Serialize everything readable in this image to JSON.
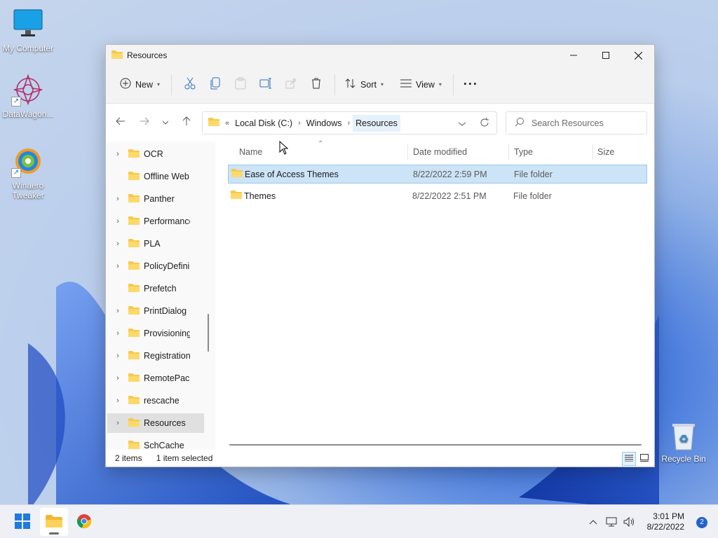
{
  "desktop": {
    "icons": [
      {
        "label": "My Computer"
      },
      {
        "label": "DataWagon..."
      },
      {
        "label": "Winaero Tweaker"
      },
      {
        "label": "Recycle Bin"
      }
    ]
  },
  "window": {
    "title": "Resources",
    "toolbar": {
      "new_label": "New",
      "sort_label": "Sort",
      "view_label": "View",
      "more_label": "···"
    },
    "address": {
      "overflow": "«",
      "crumbs": [
        "Local Disk (C:)",
        "Windows",
        "Resources"
      ]
    },
    "search": {
      "placeholder": "Search Resources"
    },
    "tree": [
      {
        "label": "OCR",
        "expandable": true
      },
      {
        "label": "Offline Web",
        "expandable": false
      },
      {
        "label": "Panther",
        "expandable": true
      },
      {
        "label": "Performance",
        "expandable": true
      },
      {
        "label": "PLA",
        "expandable": true
      },
      {
        "label": "PolicyDefini",
        "expandable": true
      },
      {
        "label": "Prefetch",
        "expandable": false
      },
      {
        "label": "PrintDialog",
        "expandable": true
      },
      {
        "label": "Provisioning",
        "expandable": true
      },
      {
        "label": "Registration",
        "expandable": true
      },
      {
        "label": "RemotePack",
        "expandable": true
      },
      {
        "label": "rescache",
        "expandable": true
      },
      {
        "label": "Resources",
        "expandable": true,
        "selected": true
      },
      {
        "label": "SchCache",
        "expandable": false
      }
    ],
    "columns": [
      "Name",
      "Date modified",
      "Type",
      "Size"
    ],
    "rows": [
      {
        "name": "Ease of Access Themes",
        "date": "8/22/2022 2:59 PM",
        "type": "File folder",
        "size": "",
        "selected": true
      },
      {
        "name": "Themes",
        "date": "8/22/2022 2:51 PM",
        "type": "File folder",
        "size": "",
        "selected": false
      }
    ],
    "status": {
      "items": "2 items",
      "selected": "1 item selected"
    }
  },
  "taskbar": {
    "time": "3:01 PM",
    "date": "8/22/2022",
    "notifications": "2"
  },
  "colors": {
    "accent": "#0067c0",
    "selection": "#cce4f7",
    "folder": "#f7c948"
  }
}
